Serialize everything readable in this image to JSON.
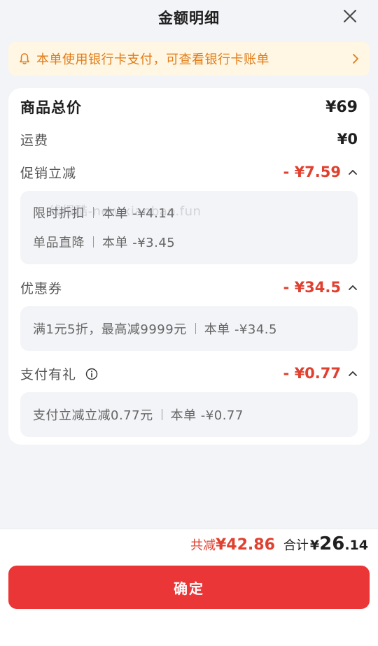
{
  "header": {
    "title": "金额明细"
  },
  "notice": {
    "text": "本单使用银行卡支付，可查看银行卡账单"
  },
  "card": {
    "goods_total": {
      "label": "商品总价",
      "value": "¥69"
    },
    "shipping": {
      "label": "运费",
      "value": "¥0"
    },
    "promotion": {
      "label": "促销立减",
      "value": "- ¥7.59",
      "items": [
        {
          "name": "限时折扣",
          "detail": "本单 -¥4.14"
        },
        {
          "name": "单品直降",
          "detail": "本单 -¥3.45"
        }
      ]
    },
    "coupon": {
      "label": "优惠券",
      "value": "- ¥34.5",
      "items": [
        {
          "name": "满1元5折，最高减9999元",
          "detail": "本单 -¥34.5"
        }
      ]
    },
    "payment_gift": {
      "label": "支付有礼",
      "value": "- ¥0.77",
      "items": [
        {
          "name": "支付立减立减0.77元",
          "detail": "本单 -¥0.77"
        }
      ]
    }
  },
  "watermark": "线报酷-new.xianbao.fun",
  "footer": {
    "saved_label": "共减",
    "saved_value": "¥42.86",
    "total_label": "合计",
    "total_currency": "¥",
    "total_integer": "26",
    "total_decimal": ".14",
    "confirm_label": "确定"
  },
  "colors": {
    "accent_red": "#e0402f",
    "notice_orange": "#e27b16",
    "button_red": "#ea3636"
  }
}
